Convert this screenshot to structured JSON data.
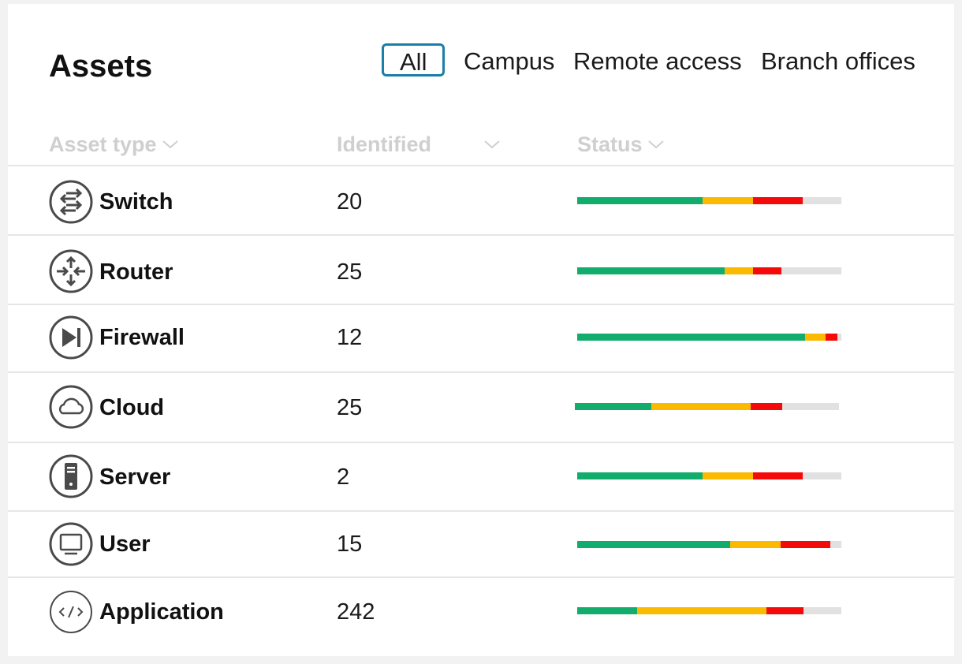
{
  "header": {
    "title": "Assets"
  },
  "tabs": [
    {
      "label": "All",
      "active": true
    },
    {
      "label": "Campus",
      "active": false
    },
    {
      "label": "Remote access",
      "active": false
    },
    {
      "label": "Branch offices",
      "active": false
    }
  ],
  "columns": {
    "asset_type": "Asset type",
    "identified": "Identified",
    "status": "Status"
  },
  "colors": {
    "good": "#12ad6c",
    "warning": "#fbb900",
    "critical": "#f50a0a",
    "track": "#e1e1e1",
    "accent": "#1a7fa6"
  },
  "rows": [
    {
      "name": "Switch",
      "icon": "switch-icon",
      "count": "20",
      "status": {
        "good": 0.475,
        "warning": 0.19,
        "critical": 0.19
      }
    },
    {
      "name": "Router",
      "icon": "router-icon",
      "count": "25",
      "status": {
        "good": 0.557,
        "warning": 0.108,
        "critical": 0.108
      }
    },
    {
      "name": "Firewall",
      "icon": "firewall-icon",
      "count": "12",
      "status": {
        "good": 0.863,
        "warning": 0.078,
        "critical": 0.045
      }
    },
    {
      "name": "Cloud",
      "icon": "cloud-icon",
      "count": "25",
      "status": {
        "good": 0.29,
        "warning": 0.376,
        "critical": 0.12
      }
    },
    {
      "name": "Server",
      "icon": "server-icon",
      "count": "2",
      "status": {
        "good": 0.475,
        "warning": 0.19,
        "critical": 0.19
      }
    },
    {
      "name": "User",
      "icon": "monitor-icon",
      "count": "15",
      "status": {
        "good": 0.579,
        "warning": 0.19,
        "critical": 0.19
      }
    },
    {
      "name": "Application",
      "icon": "code-icon",
      "count": "242",
      "status": {
        "good": 0.228,
        "warning": 0.487,
        "critical": 0.143
      }
    }
  ]
}
